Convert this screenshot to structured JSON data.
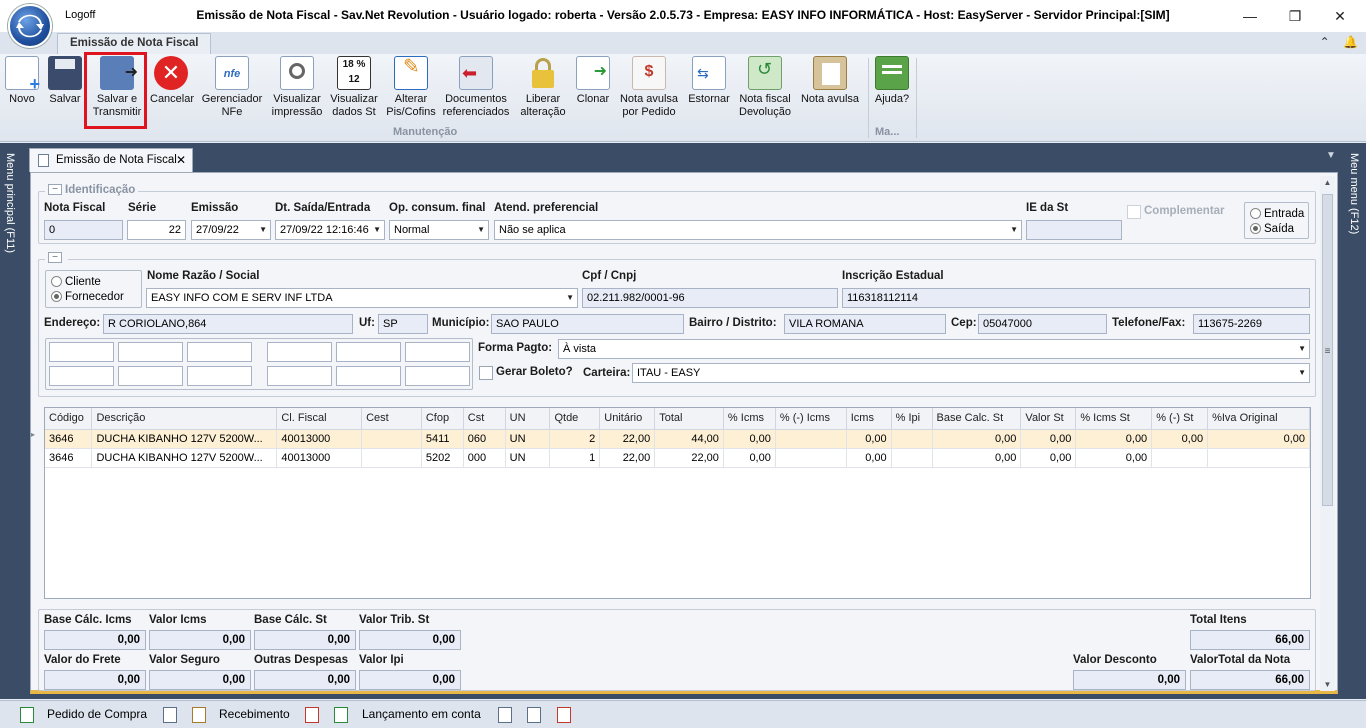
{
  "window": {
    "logoff_label": "Logoff",
    "title": "Emissão de Nota Fiscal - Sav.Net Revolution - Usuário logado: roberta - Versão 2.0.5.73 - Empresa: EASY INFO INFORMÁTICA - Host: EasyServer - Servidor Principal:[SIM]",
    "minimize": "—",
    "restore": "❐",
    "close": "✕"
  },
  "ribbon": {
    "tab_label": "Emissão de Nota Fiscal",
    "collapse_icon": "⌃",
    "bell_icon": "🔔",
    "buttons": [
      {
        "label": "Novo",
        "icon": "new-document-icon"
      },
      {
        "label": "Salvar",
        "icon": "floppy-disk-icon"
      },
      {
        "label": "Salvar e Transmitir",
        "icon": "save-transmit-icon"
      },
      {
        "label": "Cancelar",
        "icon": "cancel-icon"
      },
      {
        "label": "Gerenciador NFe",
        "icon": "nfe-manager-icon"
      },
      {
        "label": "Visualizar impressão",
        "icon": "print-preview-icon"
      },
      {
        "label": "Visualizar dados St",
        "icon": "st-data-icon"
      },
      {
        "label": "Alterar Pis/Cofins",
        "icon": "edit-pencil-icon"
      },
      {
        "label": "Documentos referenciados",
        "icon": "referenced-docs-icon"
      },
      {
        "label": "Liberar alteração",
        "icon": "padlock-icon"
      },
      {
        "label": "Clonar",
        "icon": "clone-icon"
      },
      {
        "label": "Nota avulsa por Pedido",
        "icon": "order-note-icon"
      },
      {
        "label": "Estornar",
        "icon": "reverse-icon"
      },
      {
        "label": "Nota fiscal Devolução",
        "icon": "return-note-icon"
      },
      {
        "label": "Nota avulsa",
        "icon": "clipboard-icon"
      },
      {
        "label": "Ajuda?",
        "icon": "help-book-icon"
      }
    ],
    "group_manutencao": "Manutenção",
    "group_ma": "Ma..."
  },
  "rails": {
    "left": "Menu principal (F11)",
    "right": "Meu menu (F12)"
  },
  "doc_tab": {
    "label": "Emissão de Nota Fiscal",
    "close": "✕"
  },
  "identificacao": {
    "title": "Identificação",
    "nota_fiscal_label": "Nota Fiscal",
    "nota_fiscal_value": "0",
    "serie_label": "Série",
    "serie_value": "22",
    "emissao_label": "Emissão",
    "emissao_value": "27/09/22",
    "dt_saida_label": "Dt. Saída/Entrada",
    "dt_saida_value": "27/09/22 12:16:46",
    "op_consum_label": "Op. consum. final",
    "op_consum_value": "Normal",
    "atend_label": "Atend. preferencial",
    "atend_value": "Não se aplica",
    "ie_st_label": "IE da St",
    "ie_st_value": "",
    "complementar_label": "Complementar",
    "entrada_label": "Entrada",
    "saida_label": "Saída"
  },
  "destinatario": {
    "cliente_label": "Cliente",
    "fornecedor_label": "Fornecedor",
    "nome_label": "Nome Razão / Social",
    "nome_value": "EASY INFO COM E SERV INF LTDA",
    "cpf_label": "Cpf / Cnpj",
    "cpf_value": "02.211.982/0001-96",
    "ie_label": "Inscrição Estadual",
    "ie_value": "116318112114",
    "endereco_label": "Endereço:",
    "endereco_value": "R CORIOLANO,864",
    "uf_label": "Uf:",
    "uf_value": "SP",
    "municipio_label": "Município:",
    "municipio_value": "SAO PAULO",
    "bairro_label": "Bairro / Distrito:",
    "bairro_value": "VILA ROMANA",
    "cep_label": "Cep:",
    "cep_value": "05047000",
    "telefone_label": "Telefone/Fax:",
    "telefone_value": "113675-2269",
    "forma_pagto_label": "Forma Pagto:",
    "forma_pagto_value": "À vista",
    "gerar_boleto_label": "Gerar Boleto?",
    "carteira_label": "Carteira:",
    "carteira_value": "ITAU - EASY"
  },
  "items_grid": {
    "columns": [
      "Código",
      "Descrição",
      "Cl. Fiscal",
      "Cest",
      "Cfop",
      "Cst",
      "UN",
      "Qtde",
      "Unitário",
      "Total",
      "% Icms",
      "% (-) Icms",
      "Icms",
      "% Ipi",
      "Base Calc. St",
      "Valor St",
      "% Icms St",
      "% (-) St",
      "%Iva Original"
    ],
    "rows": [
      [
        "3646",
        "DUCHA KIBANHO 127V 5200W...",
        "40013000",
        "",
        "5411",
        "060",
        "UN",
        "2",
        "22,00",
        "44,00",
        "0,00",
        "",
        "0,00",
        "",
        "0,00",
        "0,00",
        "0,00",
        "0,00",
        "0,00"
      ],
      [
        "3646",
        "DUCHA KIBANHO 127V 5200W...",
        "40013000",
        "",
        "5202",
        "000",
        "UN",
        "1",
        "22,00",
        "22,00",
        "0,00",
        "",
        "0,00",
        "",
        "0,00",
        "0,00",
        "0,00",
        "",
        ""
      ]
    ]
  },
  "totals": {
    "base_icms_label": "Base Cálc. Icms",
    "base_icms_value": "0,00",
    "valor_icms_label": "Valor Icms",
    "valor_icms_value": "0,00",
    "base_st_label": "Base Cálc. St",
    "base_st_value": "0,00",
    "valor_trib_st_label": "Valor Trib. St",
    "valor_trib_st_value": "0,00",
    "total_itens_label": "Total Itens",
    "total_itens_value": "66,00",
    "frete_label": "Valor do Frete",
    "frete_value": "0,00",
    "seguro_label": "Valor Seguro",
    "seguro_value": "0,00",
    "outras_label": "Outras Despesas",
    "outras_value": "0,00",
    "ipi_label": "Valor Ipi",
    "ipi_value": "0,00",
    "desconto_label": "Valor Desconto",
    "desconto_value": "0,00",
    "valor_total_label": "ValorTotal da Nota",
    "valor_total_value": "66,00"
  },
  "statusbar": {
    "pedido_compra": "Pedido de Compra",
    "recebimento": "Recebimento",
    "lancamento": "Lançamento em conta"
  }
}
